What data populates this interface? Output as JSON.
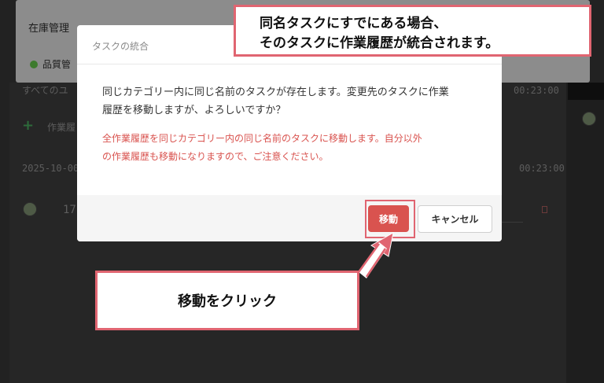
{
  "background": {
    "header_title": "在庫管理",
    "category_label": "品質管",
    "all_users_label": "すべてのユ",
    "total_time_top": "00:23:00",
    "add_work_label": "作業履",
    "date": "2025-10-00",
    "total_time_day": "00:23:00",
    "row_time": "17:"
  },
  "modal": {
    "title": "タスクの統合",
    "message_line1": "同じカテゴリー内に同じ名前のタスクが存在します。変更先のタスクに作業",
    "message_line2": "履歴を移動しますが、よろしいですか？",
    "warning_line1": "全作業履歴を同じカテゴリー内の同じ名前のタスクに移動します。自分以外",
    "warning_line2": "の作業履歴も移動になりますので、ご注意ください。",
    "move_button": "移動",
    "cancel_button": "キャンセル"
  },
  "annotations": {
    "top_line1": "同名タスクにすでにある場合、",
    "top_line2": "そのタスクに作業履歴が統合されます。",
    "bottom": "移動をクリック",
    "accent_color": "#e06571"
  },
  "colors": {
    "danger": "#d9534f",
    "overlay_dark": "#222222"
  }
}
